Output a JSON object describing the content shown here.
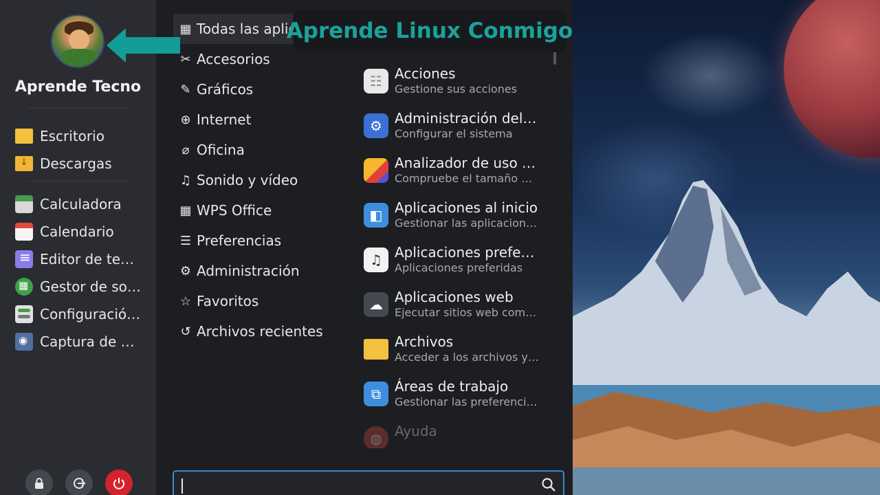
{
  "banner": {
    "text": "Aprende Linux Conmigo"
  },
  "user": {
    "name": "Aprende Tecno"
  },
  "places": [
    {
      "label": "Escritorio",
      "icon": "folder-icon"
    },
    {
      "label": "Descargas",
      "icon": "download-folder-icon"
    }
  ],
  "favorites": [
    {
      "label": "Calculadora",
      "icon": "calculator-icon"
    },
    {
      "label": "Calendario",
      "icon": "calendar-icon"
    },
    {
      "label": "Editor de te…",
      "icon": "text-editor-icon"
    },
    {
      "label": "Gestor de so…",
      "icon": "software-manager-icon"
    },
    {
      "label": "Configuració…",
      "icon": "settings-icon"
    },
    {
      "label": "Captura de …",
      "icon": "screenshot-icon"
    }
  ],
  "categories": [
    {
      "label": "Todas las aplic",
      "icon": "grid-icon",
      "glyph": "▦"
    },
    {
      "label": "Accesorios",
      "icon": "tools-icon",
      "glyph": "✂"
    },
    {
      "label": "Gráficos",
      "icon": "graphics-icon",
      "glyph": "✎"
    },
    {
      "label": "Internet",
      "icon": "globe-icon",
      "glyph": "⊕"
    },
    {
      "label": "Oficina",
      "icon": "paperclip-icon",
      "glyph": "⌀"
    },
    {
      "label": "Sonido y vídeo",
      "icon": "media-icon",
      "glyph": "♫"
    },
    {
      "label": "WPS Office",
      "icon": "grid-icon",
      "glyph": "▦"
    },
    {
      "label": "Preferencias",
      "icon": "sliders-icon",
      "glyph": "☰"
    },
    {
      "label": "Administración",
      "icon": "gear-icon",
      "glyph": "⚙"
    },
    {
      "label": "Favoritos",
      "icon": "star-icon",
      "glyph": "☆"
    },
    {
      "label": "Archivos recientes",
      "icon": "history-icon",
      "glyph": "↺"
    }
  ],
  "apps": [
    {
      "name": "Acciones",
      "desc": "Gestione sus acciones",
      "icon": "actions-icon",
      "color": "#e9e9ea",
      "glyph": "☷"
    },
    {
      "name": "Administración del…",
      "desc": "Configurar el sistema",
      "icon": "system-admin-icon",
      "color": "#3b6fd1",
      "glyph": "⚙"
    },
    {
      "name": "Analizador de uso …",
      "desc": "Compruebe el tamaño …",
      "icon": "disk-usage-icon",
      "color": "#f0a02a",
      "glyph": "◔"
    },
    {
      "name": "Aplicaciones al inicio",
      "desc": "Gestionar las aplicacion…",
      "icon": "startup-apps-icon",
      "color": "#3d8fde",
      "glyph": "◧"
    },
    {
      "name": "Aplicaciones prefe…",
      "desc": "Aplicaciones preferidas",
      "icon": "preferred-apps-icon",
      "color": "#f2f2f2",
      "glyph": "♫"
    },
    {
      "name": "Aplicaciones web",
      "desc": "Ejecutar sitios web com…",
      "icon": "web-apps-icon",
      "color": "#444851",
      "glyph": "☁"
    },
    {
      "name": "Archivos",
      "desc": "Acceder a los archivos y…",
      "icon": "files-icon",
      "color": "#f3c040",
      "glyph": ""
    },
    {
      "name": "Áreas de trabajo",
      "desc": "Gestionar las preferenci…",
      "icon": "workspaces-icon",
      "color": "#3d8fde",
      "glyph": "⧉"
    },
    {
      "name": "Ayuda",
      "desc": "",
      "icon": "help-icon",
      "color": "#d34a3a",
      "glyph": "◍"
    }
  ],
  "search": {
    "value": "",
    "placeholder": ""
  },
  "session_buttons": [
    {
      "label": "lock",
      "icon": "lock-icon",
      "glyph": "🔒"
    },
    {
      "label": "logout",
      "icon": "logout-icon",
      "glyph": "⇥"
    },
    {
      "label": "power",
      "icon": "power-icon",
      "glyph": "⏻"
    }
  ]
}
